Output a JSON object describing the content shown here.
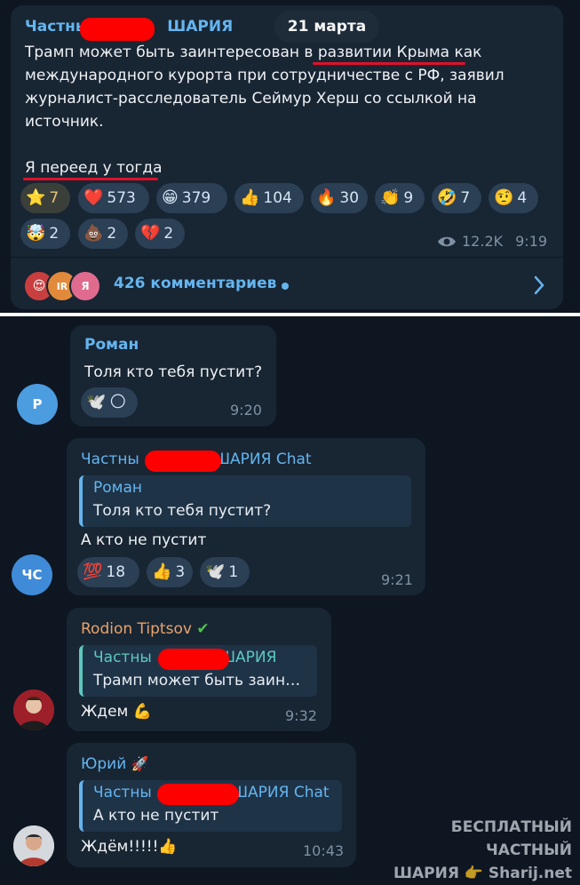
{
  "channel_post": {
    "channel_name_left": "Частны",
    "channel_name_right": "ШАРИЯ",
    "date_badge": "21 марта",
    "text_lines": [
      "Трамп может быть заинтересован в развитии Крыма как",
      "международного курорта при сотрудничестве с РФ, заявил",
      "журналист-расследователь Сеймур Херш со ссылкой на",
      "источник."
    ],
    "text_line2": "Я переед у тогда",
    "reactions": [
      {
        "emoji": "⭐",
        "count": "7"
      },
      {
        "emoji": "❤️",
        "count": "573"
      },
      {
        "emoji": "😁",
        "count": "379"
      },
      {
        "emoji": "👍",
        "count": "104"
      },
      {
        "emoji": "🔥",
        "count": "30"
      },
      {
        "emoji": "👏",
        "count": "9"
      },
      {
        "emoji": "🤣",
        "count": "7"
      },
      {
        "emoji": "🤨",
        "count": "4"
      },
      {
        "emoji": "🤯",
        "count": "2"
      },
      {
        "emoji": "💩",
        "count": "2"
      },
      {
        "emoji": "💔",
        "count": "2"
      }
    ],
    "views": "12.2K",
    "time": "9:19",
    "comments": "426 комментариев",
    "comment_avatars": [
      "IR",
      "Я"
    ]
  },
  "messages": [
    {
      "author": "Роман",
      "avatar_letter": "Р",
      "text": "Толя кто тебя пустит?",
      "reactions": [
        "🕊️",
        "🌕"
      ],
      "time": "9:20"
    },
    {
      "author_left": "Частны",
      "author_right": "ШАРИЯ Chat",
      "avatar_letter": "ЧС",
      "reply_name": "Роман",
      "reply_text": "Толя кто тебя пустит?",
      "text": "А кто не пустит",
      "reactions": [
        {
          "emoji": "💯",
          "count": "18"
        },
        {
          "emoji": "👍",
          "count": "3"
        },
        {
          "emoji": "🕊️",
          "count": "1"
        }
      ],
      "time": "9:21"
    },
    {
      "author": "Rodion Tiptsov",
      "reply_name_left": "Частны",
      "reply_name_right": "ШАРИЯ",
      "reply_text": "Трамп может быть заин…",
      "text": "Ждем 💪",
      "time": "9:32"
    },
    {
      "author": "Юрий",
      "reply_name_left": "Частны",
      "reply_name_right": "ШАРИЯ Chat",
      "reply_text": "А кто не пустит",
      "text": "Ждём!!!!!👍",
      "time": "10:43"
    }
  ],
  "watermark": {
    "line1": "БЕСПЛАТНЫЙ ЧАСТНЫЙ",
    "line2_left": "ШАРИЯ",
    "line2_right": "Sharij.net"
  },
  "colors": {
    "background": "#0e1621",
    "bubble": "#182533",
    "link": "#64b5ef",
    "redaction": "#ff0000"
  }
}
